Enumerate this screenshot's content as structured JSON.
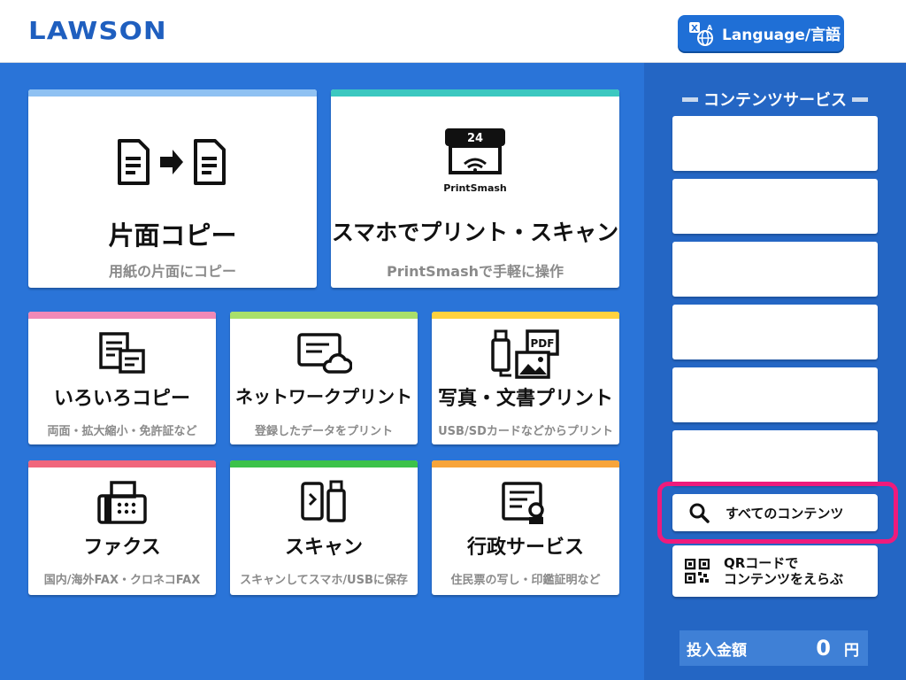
{
  "header": {
    "logo": "LAWSON",
    "language_button": "Language/言語"
  },
  "tiles": [
    {
      "id": "single-copy",
      "title": "片面コピー",
      "subtitle": "用紙の片面にコピー",
      "color": "#8fc1f2"
    },
    {
      "id": "smartphone-print",
      "title": "スマホでプリント・スキャン",
      "subtitle": "PrintSmashで手軽に操作",
      "color": "#3cc8c0",
      "icon_badge": "24",
      "icon_label": "PrintSmash"
    },
    {
      "id": "various-copy",
      "title": "いろいろコピー",
      "subtitle": "両面・拡大縮小・免許証など",
      "color": "#f189b7"
    },
    {
      "id": "network-print",
      "title": "ネットワークプリント",
      "subtitle": "登録したデータをプリント",
      "color": "#a9e06a"
    },
    {
      "id": "photo-document-print",
      "title": "写真・文書プリント",
      "subtitle": "USB/SDカードなどからプリント",
      "color": "#ffd23f",
      "icon_label": "PDF"
    },
    {
      "id": "fax",
      "title": "ファクス",
      "subtitle": "国内/海外FAX・クロネコFAX",
      "color": "#f0667c"
    },
    {
      "id": "scan",
      "title": "スキャン",
      "subtitle": "スキャンしてスマホ/USBに保存",
      "color": "#3cc24a"
    },
    {
      "id": "government-services",
      "title": "行政サービス",
      "subtitle": "住民票の写し・印鑑証明など",
      "color": "#f7a43a"
    }
  ],
  "panel": {
    "title": "コンテンツサービス",
    "content_slots": [
      "",
      "",
      "",
      "",
      "",
      ""
    ],
    "all_contents_button": "すべてのコンテンツ",
    "qr_button_line1": "QRコードで",
    "qr_button_line2": "コンテンツをえらぶ",
    "payment_label": "投入金額",
    "payment_amount": "0",
    "payment_unit": "円"
  },
  "colors": {
    "background": "#2a74d8",
    "panel": "#2466c4",
    "highlight": "#ee1b7c",
    "brand": "#1f5fbf"
  }
}
